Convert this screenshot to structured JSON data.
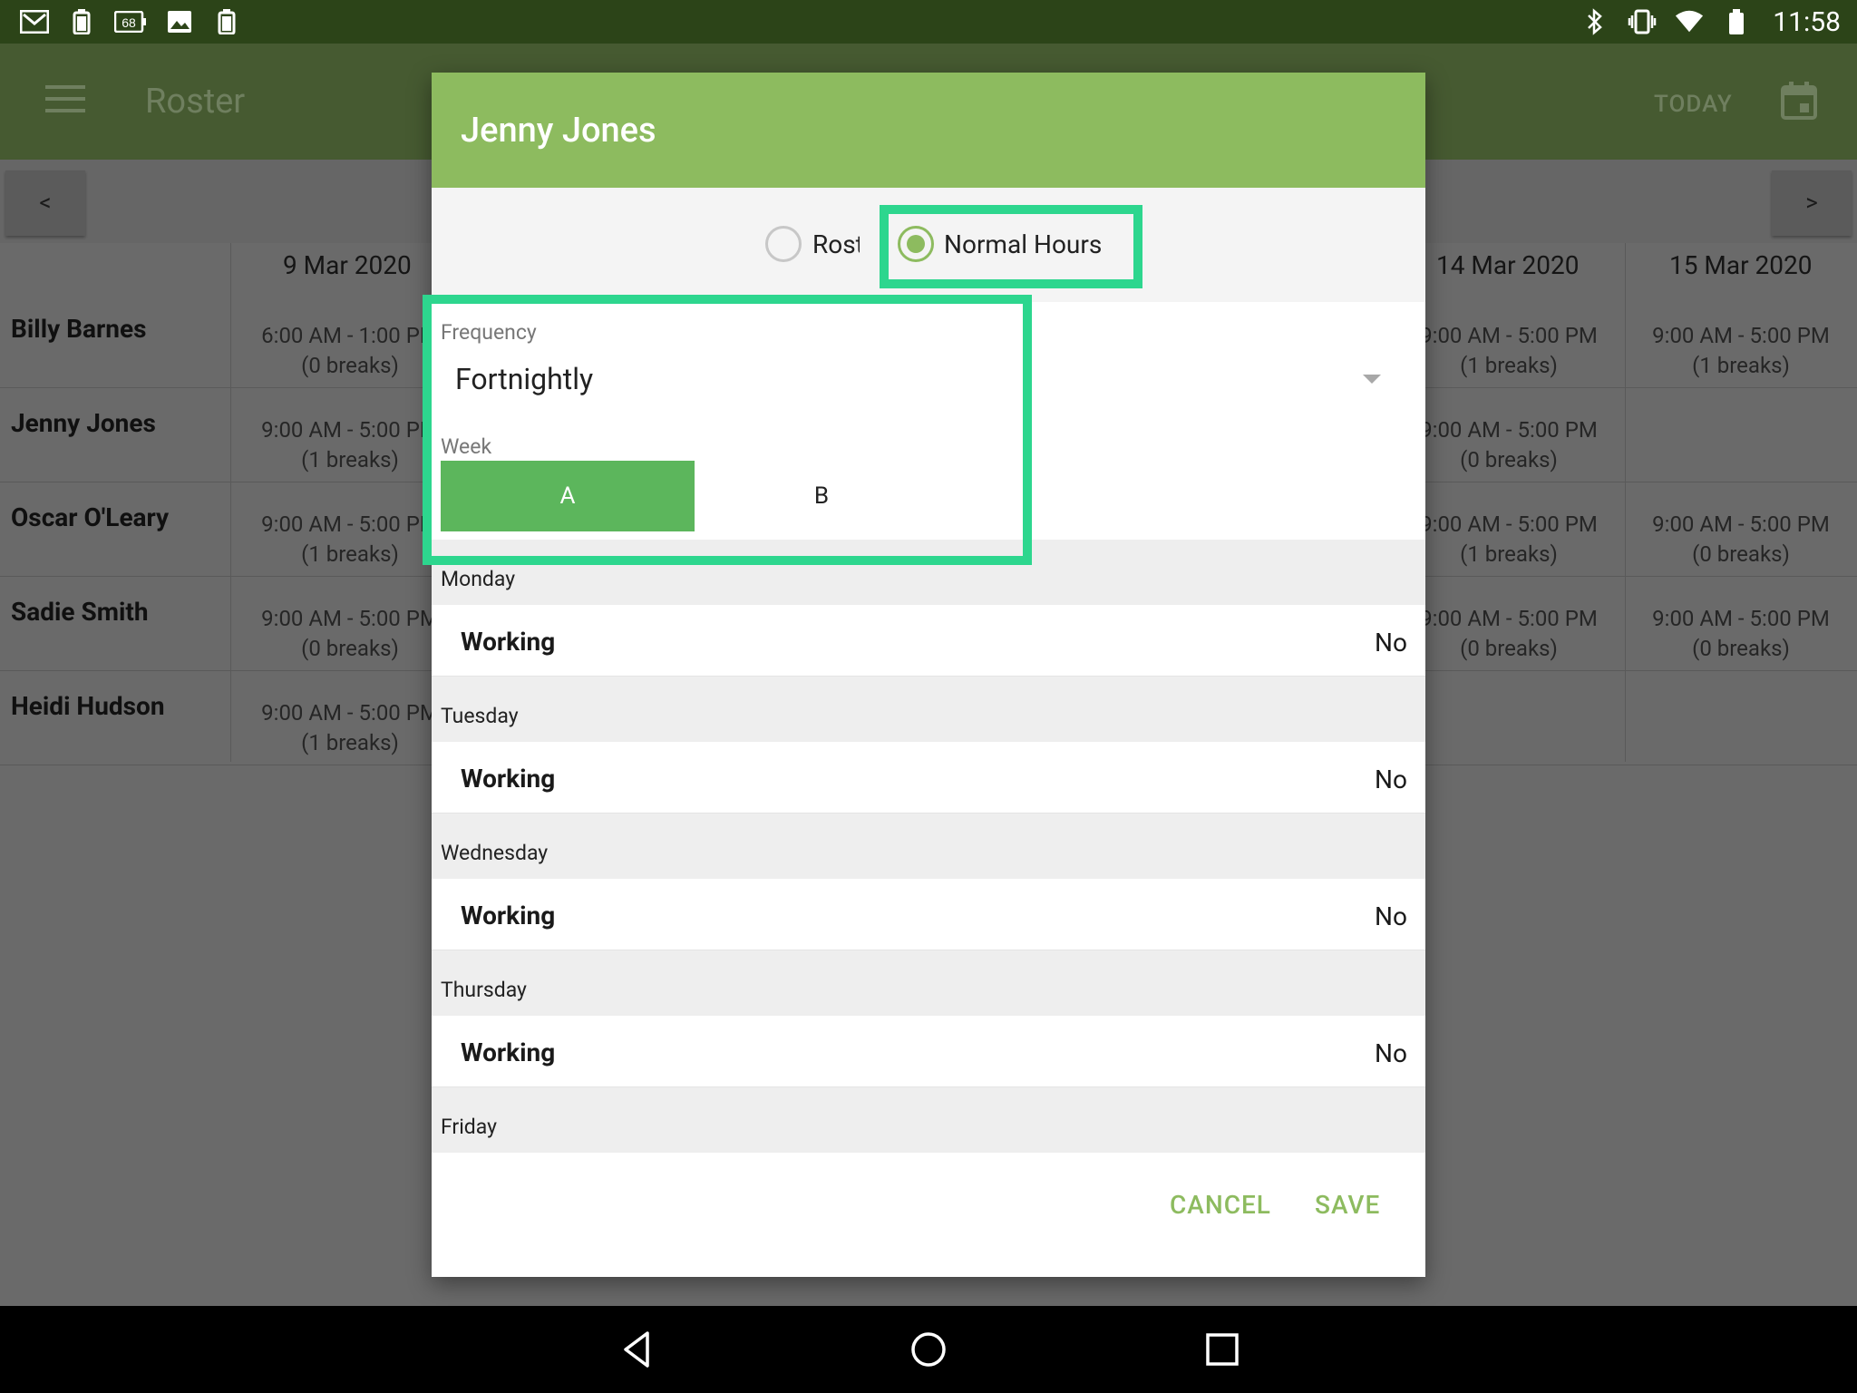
{
  "status_bar": {
    "time": "11:58",
    "left_icons": [
      "gmail-icon",
      "battery-small-icon",
      "battery-68-icon",
      "image-icon",
      "battery-small-icon"
    ],
    "battery_badge": "68",
    "right_icons": [
      "bluetooth-icon",
      "vibrate-icon",
      "wifi-icon",
      "battery-icon"
    ]
  },
  "app_bar": {
    "title": "Roster",
    "today_label": "TODAY",
    "menu_icon": "hamburger-menu-icon",
    "calendar_icon": "calendar-icon"
  },
  "roster": {
    "prev_label": "<",
    "next_label": ">",
    "dates": [
      "9 Mar 2020",
      "14 Mar 2020",
      "15 Mar 2020"
    ],
    "rows": [
      {
        "name": "Billy Barnes",
        "c1": [
          "6:00 AM - 1:00 PM",
          "(0 breaks)"
        ],
        "c2": [
          "9:00 AM - 5:00 PM",
          "(1 breaks)"
        ],
        "c3": [
          "9:00 AM - 5:00 PM",
          "(1 breaks)"
        ]
      },
      {
        "name": "Jenny Jones",
        "c1": [
          "9:00 AM - 5:00 PM",
          "(1 breaks)"
        ],
        "c2": [
          "9:00 AM - 5:00 PM",
          "(0 breaks)"
        ],
        "c3": [
          "",
          ""
        ]
      },
      {
        "name": "Oscar O'Leary",
        "c1": [
          "9:00 AM - 5:00 PM",
          "(1 breaks)"
        ],
        "c2": [
          "9:00 AM - 5:00 PM",
          "(1 breaks)"
        ],
        "c3": [
          "9:00 AM - 5:00 PM",
          "(0 breaks)"
        ]
      },
      {
        "name": "Sadie Smith",
        "c1": [
          "9:00 AM - 5:00 PM",
          "(0 breaks)"
        ],
        "c2": [
          "9:00 AM - 5:00 PM",
          "(0 breaks)"
        ],
        "c3": [
          "9:00 AM - 5:00 PM",
          "(0 breaks)"
        ]
      },
      {
        "name": "Heidi Hudson",
        "c1": [
          "9:00 AM - 5:00 PM",
          "(1 breaks)"
        ],
        "c2": [
          "",
          ""
        ],
        "c3": [
          "",
          ""
        ]
      }
    ]
  },
  "dialog": {
    "title": "Jenny Jones",
    "mode_options": {
      "roster": "Roster",
      "normal_hours": "Normal Hours"
    },
    "selected_mode": "normal_hours",
    "frequency_label": "Frequency",
    "frequency_value": "Fortnightly",
    "week_label": "Week",
    "week_a": "A",
    "week_b": "B",
    "selected_week": "A",
    "days": [
      {
        "day": "Monday",
        "label": "Working",
        "value": "No"
      },
      {
        "day": "Tuesday",
        "label": "Working",
        "value": "No"
      },
      {
        "day": "Wednesday",
        "label": "Working",
        "value": "No"
      },
      {
        "day": "Thursday",
        "label": "Working",
        "value": "No"
      }
    ],
    "partial_day": "Friday",
    "cancel_label": "CANCEL",
    "save_label": "SAVE"
  },
  "colors": {
    "accent": "#8dbb5f",
    "week_selected": "#5cb65c",
    "highlight": "#2dd68e",
    "status_bar": "#2c4418"
  },
  "system_nav": {
    "icons": [
      "back-icon",
      "home-icon",
      "recents-icon"
    ]
  }
}
